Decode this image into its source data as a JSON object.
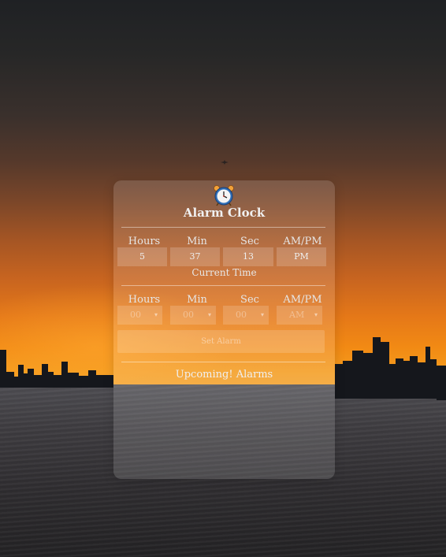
{
  "app": {
    "title": "Alarm Clock",
    "icon": "alarm-clock-icon"
  },
  "current_time": {
    "labels": [
      "Hours",
      "Min",
      "Sec",
      "AM/PM"
    ],
    "values": [
      "5",
      "37",
      "13",
      "PM"
    ],
    "caption": "Current Time"
  },
  "set_alarm": {
    "labels": [
      "Hours",
      "Min",
      "Sec",
      "AM/PM"
    ],
    "selects": [
      "00",
      "00",
      "00",
      "AM"
    ],
    "button_label": "Set Alarm"
  },
  "upcoming": {
    "heading": "Upcoming! Alarms"
  },
  "colors": {
    "card_bg": "rgba(255,255,255,0.14)",
    "text": "#ededed",
    "sunset_orange": "#f28a14"
  }
}
